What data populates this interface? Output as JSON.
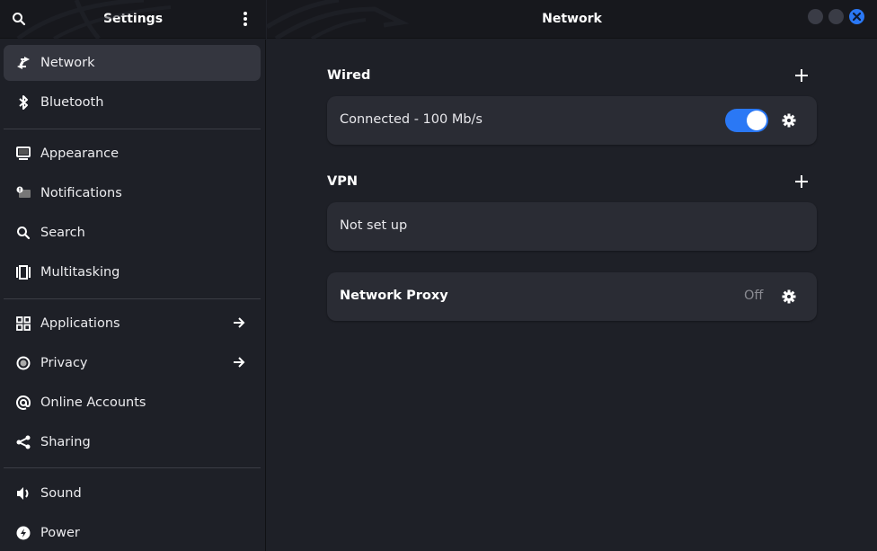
{
  "sidebar_header": {
    "title": "Settings",
    "search_icon": "search-icon",
    "menu_icon": "vertical-dots-icon"
  },
  "main_header": {
    "title": "Network",
    "window_controls": [
      "minimize",
      "maximize",
      "close"
    ]
  },
  "sidebar": {
    "items": [
      {
        "label": "Network",
        "icon": "network-arrows-icon",
        "active": true
      },
      {
        "label": "Bluetooth",
        "icon": "bluetooth-icon"
      },
      {
        "label": "Appearance",
        "icon": "display-icon"
      },
      {
        "label": "Notifications",
        "icon": "notification-bubble-icon"
      },
      {
        "label": "Search",
        "icon": "search-icon"
      },
      {
        "label": "Multitasking",
        "icon": "multitasking-icon"
      },
      {
        "label": "Applications",
        "icon": "grid-icon",
        "has_arrow": true
      },
      {
        "label": "Privacy",
        "icon": "privacy-target-icon",
        "has_arrow": true
      },
      {
        "label": "Online Accounts",
        "icon": "at-sign-icon"
      },
      {
        "label": "Sharing",
        "icon": "share-icon"
      },
      {
        "label": "Sound",
        "icon": "speaker-icon"
      },
      {
        "label": "Power",
        "icon": "power-bolt-icon"
      }
    ]
  },
  "main": {
    "wired": {
      "title": "Wired",
      "connection_status": "Connected - 100 Mb/s",
      "enabled": true
    },
    "vpn": {
      "title": "VPN",
      "status": "Not set up"
    },
    "proxy": {
      "label": "Network Proxy",
      "status": "Off"
    }
  },
  "colors": {
    "accent": "#2a78f5",
    "background": "#1e2027",
    "card": "#2a2c34",
    "header": "#17181d"
  }
}
